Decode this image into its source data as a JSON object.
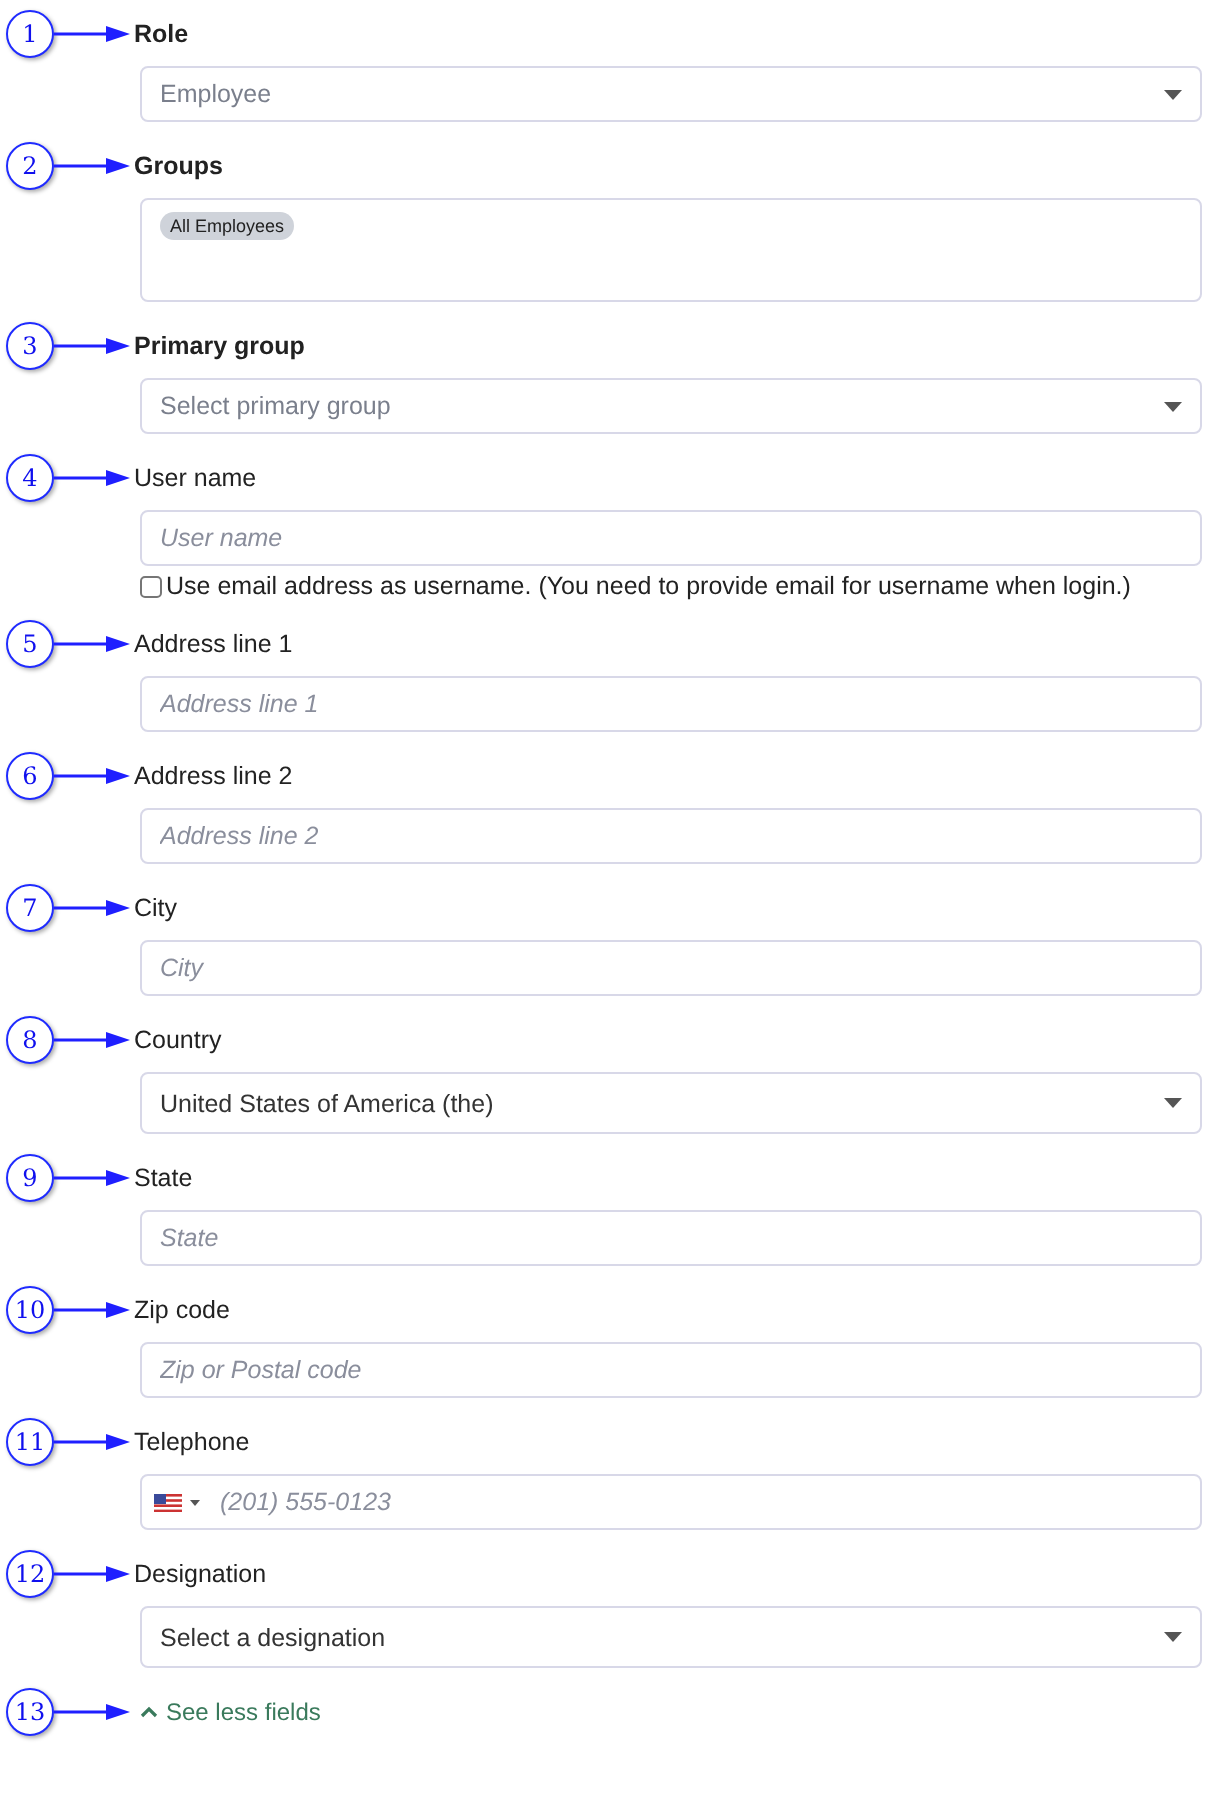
{
  "fields": [
    {
      "number": "1",
      "label": "Role",
      "kind": "select",
      "placeholder": "Employee"
    },
    {
      "number": "2",
      "label": "Groups",
      "kind": "tags",
      "tags": [
        "All Employees"
      ]
    },
    {
      "number": "3",
      "label": "Primary group",
      "kind": "select",
      "placeholder": "Select primary group"
    },
    {
      "number": "4",
      "label": "User name",
      "kind": "text",
      "placeholder": "User name",
      "checkbox": {
        "label": "Use email address as username. (You need to provide email for username when login.)",
        "checked": false
      }
    },
    {
      "number": "5",
      "label": "Address line 1",
      "kind": "text",
      "placeholder": "Address line 1"
    },
    {
      "number": "6",
      "label": "Address line 2",
      "kind": "text",
      "placeholder": "Address line 2"
    },
    {
      "number": "7",
      "label": "City",
      "kind": "text",
      "placeholder": "City"
    },
    {
      "number": "8",
      "label": "Country",
      "kind": "select",
      "value": "United States of America (the)"
    },
    {
      "number": "9",
      "label": "State",
      "kind": "text",
      "placeholder": "State"
    },
    {
      "number": "10",
      "label": "Zip code",
      "kind": "text",
      "placeholder": "Zip or Postal code"
    },
    {
      "number": "11",
      "label": "Telephone",
      "kind": "phone",
      "placeholder": "(201) 555-0123"
    },
    {
      "number": "12",
      "label": "Designation",
      "kind": "select",
      "value": "Select a designation"
    }
  ],
  "toggle": {
    "number": "13",
    "label": "See less fields",
    "expanded": true
  }
}
